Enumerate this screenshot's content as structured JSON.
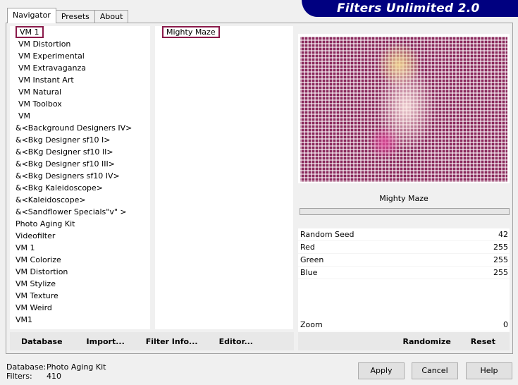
{
  "header": {
    "title": "Filters Unlimited 2.0"
  },
  "tabs": [
    {
      "label": "Navigator",
      "active": true
    },
    {
      "label": "Presets"
    },
    {
      "label": "About"
    }
  ],
  "categories": {
    "selected": "VM 1",
    "items": [
      "VM 1",
      "VM Distortion",
      "VM Experimental",
      "VM Extravaganza",
      "VM Instant Art",
      "VM Natural",
      "VM Toolbox",
      "VM",
      "&<Background Designers IV>",
      "&<Bkg Designer sf10 I>",
      "&<BKg Designer sf10 II>",
      "&<Bkg Designer sf10 III>",
      "&<Bkg Designers sf10 IV>",
      "&<Bkg Kaleidoscope>",
      "&<Kaleidoscope>",
      "&<Sandflower Specials\"v\" >",
      "Photo Aging Kit",
      "Videofilter",
      "VM 1",
      "VM Colorize",
      "VM Distortion",
      "VM Stylize",
      "VM Texture",
      "VM Weird",
      "VM1"
    ]
  },
  "filters": {
    "selected": "Mighty Maze",
    "items": [
      "Mighty Maze"
    ]
  },
  "params": {
    "title": "Mighty Maze",
    "rows": [
      {
        "label": "Random Seed",
        "value": "42"
      },
      {
        "label": "Red",
        "value": "255"
      },
      {
        "label": "Green",
        "value": "255"
      },
      {
        "label": "Blue",
        "value": "255"
      }
    ],
    "zoom": {
      "label": "Zoom",
      "value": "0"
    }
  },
  "left_buttons": {
    "database": "Database",
    "import": "Import...",
    "filter_info": "Filter Info...",
    "editor": "Editor..."
  },
  "right_buttons": {
    "randomize": "Randomize",
    "reset": "Reset"
  },
  "footer": {
    "database_label": "Database:",
    "database_value": "Photo Aging Kit",
    "filters_label": "Filters:",
    "filters_value": "410",
    "apply": "Apply",
    "cancel": "Cancel",
    "help": "Help"
  },
  "colors": {
    "banner": "#000080",
    "selection_outline": "#8a1a4a",
    "maze": "#8b2a5d"
  }
}
